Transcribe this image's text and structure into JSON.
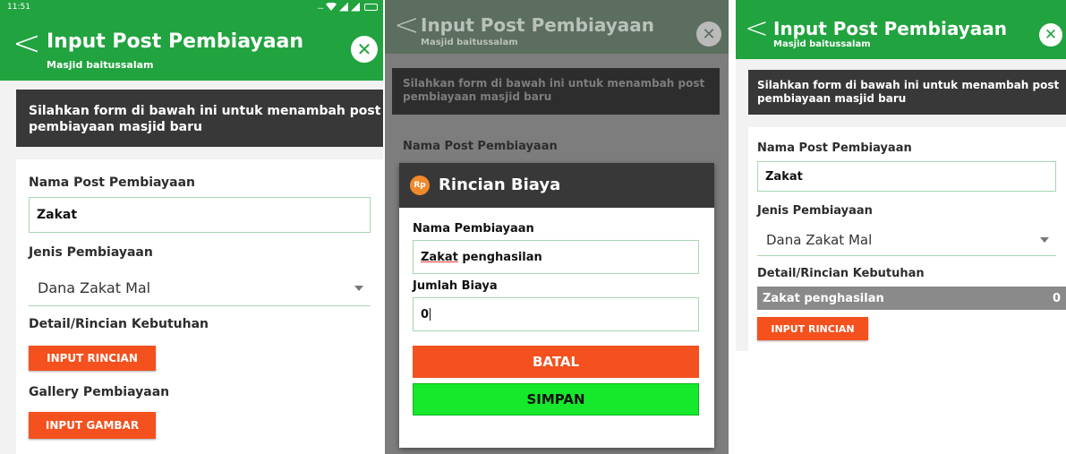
{
  "status_bar": {
    "time": "11:51"
  },
  "app_bar": {
    "title": "Input Post Pembiayaan",
    "subtitle": "Masjid baitussalam",
    "back_icon": "chevron-left-icon",
    "close_icon": "close-icon"
  },
  "info_text": "Silahkan form di bawah ini untuk menambah post pembiayaan masjid baru",
  "form": {
    "nama_label": "Nama Post Pembiayaan",
    "nama_value": "Zakat",
    "jenis_label": "Jenis Pembiayaan",
    "jenis_value": "Dana Zakat Mal",
    "detail_label": "Detail/Rincian Kebutuhan",
    "input_rincian_button": "INPUT RINCIAN",
    "gallery_label": "Gallery Pembiayaan",
    "input_gambar_button": "INPUT GAMBAR"
  },
  "dialog": {
    "icon_text": "Rp",
    "title": "Rincian Biaya",
    "nama_label": "Nama Pembiayaan",
    "nama_value_underlined": "Zakat",
    "nama_value_rest": " penghasilan",
    "jumlah_label": "Jumlah Biaya",
    "jumlah_value": "0",
    "batal_button": "BATAL",
    "simpan_button": "SIMPAN"
  },
  "detail_items": [
    {
      "name": "Zakat penghasilan",
      "amount": "0"
    }
  ],
  "colors": {
    "primary": "#21a33f",
    "accent": "#f4511e",
    "save": "#16e82c",
    "dark_bar": "#383838"
  }
}
